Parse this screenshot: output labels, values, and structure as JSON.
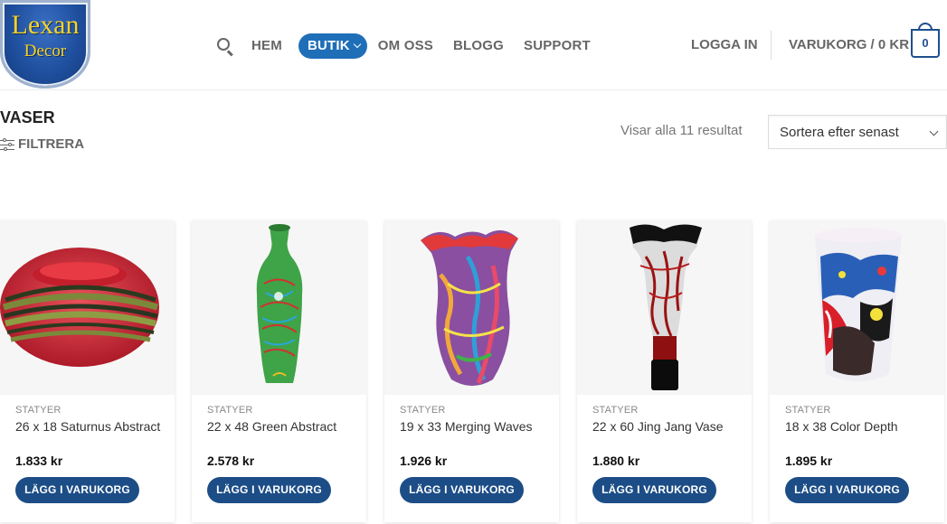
{
  "logo": {
    "line1": "Lexan",
    "line2": "Decor"
  },
  "nav": {
    "items": [
      "HEM",
      "BUTIK",
      "OM OSS",
      "BLOGG",
      "SUPPORT"
    ],
    "active_index": 1,
    "login": "LOGGA IN",
    "cart": "VARUKORG / 0 KR",
    "cart_count": "0"
  },
  "page": {
    "title": "VASER",
    "filter": "FILTRERA",
    "results": "Visar alla 11 resultat",
    "sort_selected": "Sortera efter senast"
  },
  "colors": {
    "accent": "#1f6fb8",
    "button": "#1c4d86",
    "cart": "#1f4f8e"
  },
  "products": [
    {
      "category": "STATYER",
      "name": "26 x 18 Saturnus Abstract",
      "price": "1.833 kr",
      "button": "LÄGG I VARUKORG",
      "image": "red-green-striped-bowl-vase"
    },
    {
      "category": "STATYER",
      "name": "22 x 48 Green Abstract",
      "price": "2.578 kr",
      "button": "LÄGG I VARUKORG",
      "image": "green-swirl-vase"
    },
    {
      "category": "STATYER",
      "name": "19 x 33 Merging Waves",
      "price": "1.926 kr",
      "button": "LÄGG I VARUKORG",
      "image": "multicolor-wave-vase"
    },
    {
      "category": "STATYER",
      "name": "22 x 60 Jing Jang Vase",
      "price": "1.880 kr",
      "button": "LÄGG I VARUKORG",
      "image": "black-white-red-tulip-vase"
    },
    {
      "category": "STATYER",
      "name": "18 x 38 Color Depth",
      "price": "1.895 kr",
      "button": "LÄGG I VARUKORG",
      "image": "colorful-tall-vase"
    }
  ]
}
